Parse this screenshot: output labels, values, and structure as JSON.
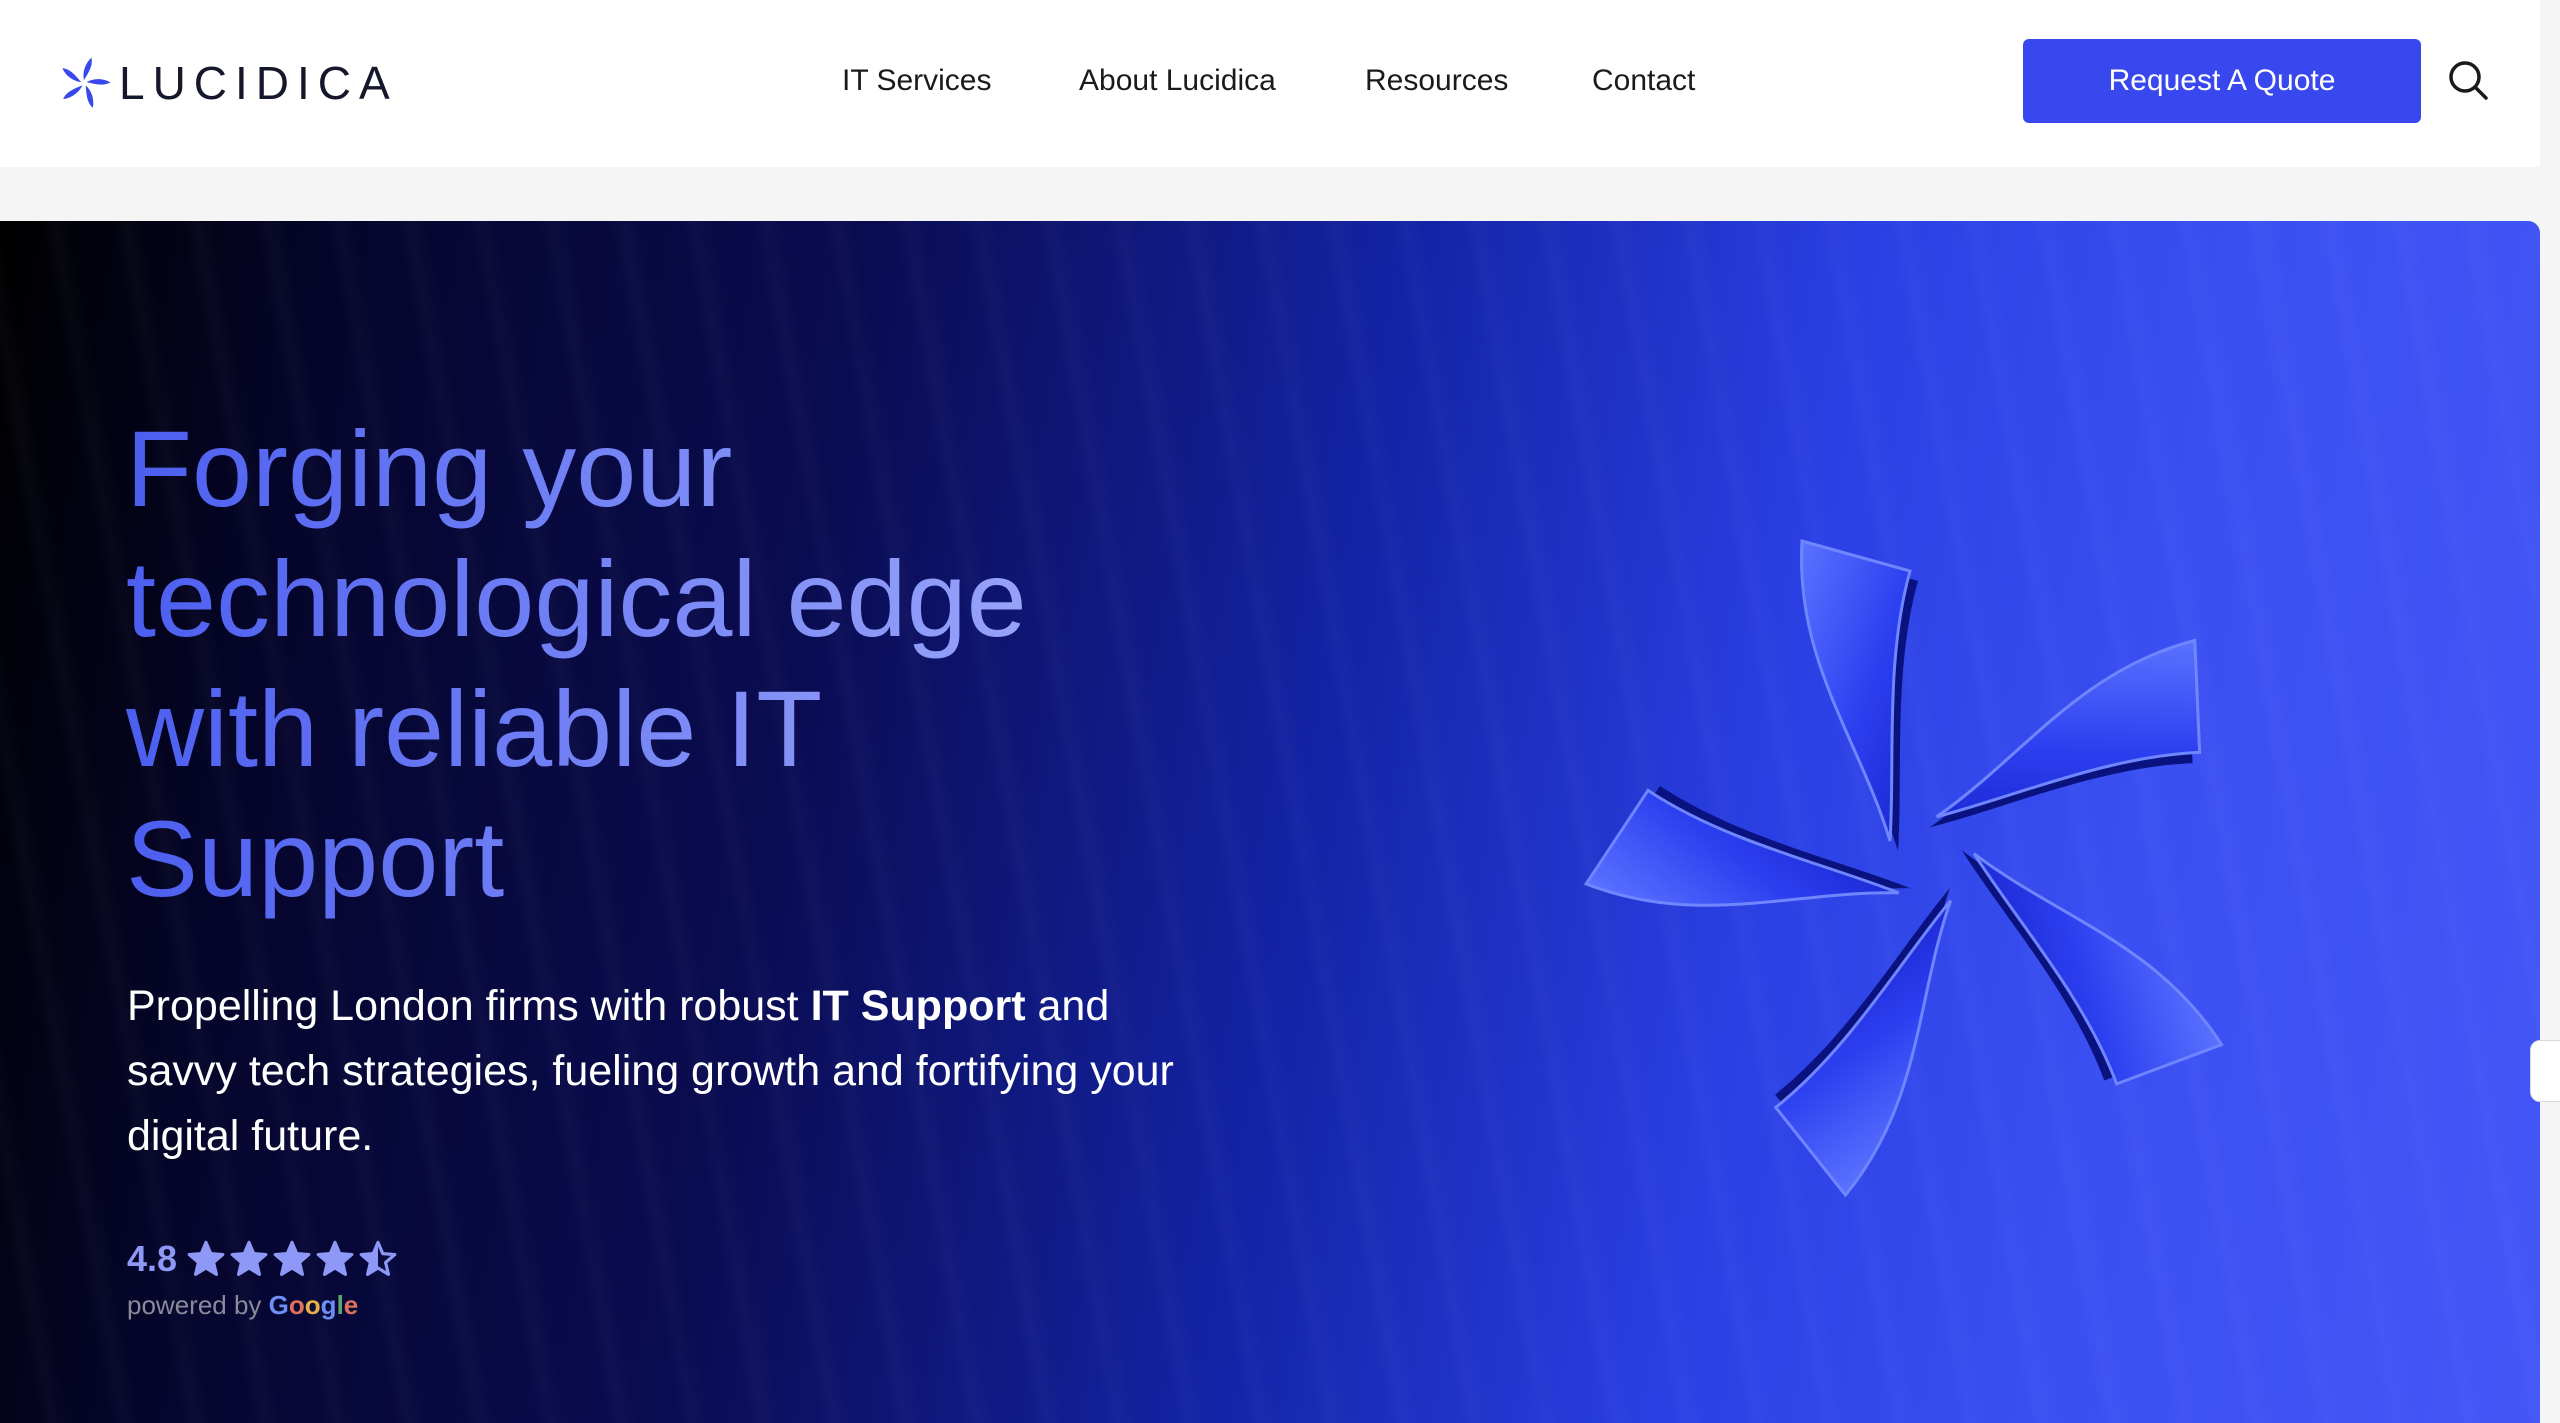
{
  "brand": {
    "name": "LUCIDICA",
    "accent": "#3848ee",
    "logo_icon": "pinwheel-logo-icon"
  },
  "nav": {
    "items": [
      {
        "label": "IT Services"
      },
      {
        "label": "About Lucidica"
      },
      {
        "label": "Resources"
      },
      {
        "label": "Contact"
      }
    ]
  },
  "header": {
    "cta_label": "Request A Quote",
    "search_icon": "search-icon"
  },
  "hero": {
    "headline": "Forging your technological edge with reliable IT Support",
    "subtext_before": "Propelling London firms with robust ",
    "subtext_bold": "IT Support",
    "subtext_after": " and savvy tech strategies, fueling growth and fortifying your digital future.",
    "rating": {
      "value": "4.8",
      "stars": 4.5,
      "max_stars": 5,
      "powered_by": "powered by",
      "provider": "Google"
    },
    "illustration": "blue-glass-pinwheel"
  }
}
